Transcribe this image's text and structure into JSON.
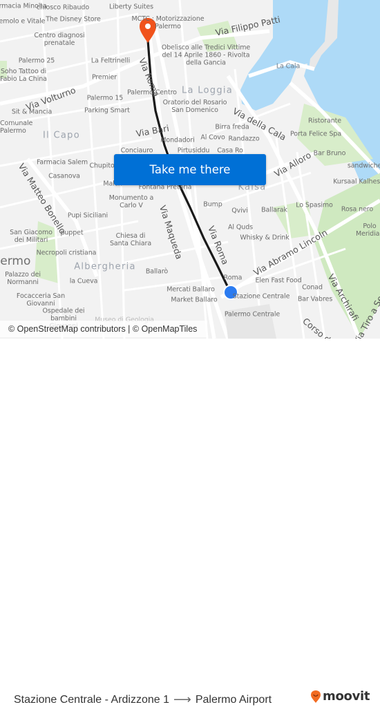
{
  "map": {
    "districts": [
      "La Loggia",
      "Il Capo",
      "Kalsa",
      "Albergheria"
    ],
    "city_label": "Palermo",
    "water_label": "La Cala",
    "streets": [
      "Via Filippo Patti",
      "Via Roma",
      "Via Volturno",
      "Via della Cala",
      "Via Bari",
      "Via Alloro",
      "Via Matteo Bonello",
      "Via Maqueda",
      "Via Roma",
      "Via Abramo Lincoln",
      "Via Archirafi",
      "Corso dei Mille",
      "Via Tiro a Segno"
    ],
    "pois": [
      "Farmacia Minolta",
      "chiosco Ribaudo",
      "Liberty Suites",
      "Tremolo e Vitale",
      "The Disney Store",
      "MCTC : Motorizzazione Palermo",
      "Centro diagnosi prenatale",
      "Palermo 25",
      "La Feltrinelli",
      "Obelisco alle Tredici Vittime del 14 Aprile 1860 - Rivolta della Gancia",
      "Soho Tattoo di Fabio La China",
      "Premier",
      "Palermo Centro",
      "Palermo 15",
      "Oratorio del Rosario San Domenico",
      "Sit & Mancia",
      "Parking Smart",
      "Comunale Palermo",
      "Birra freda",
      "Mondadori",
      "Al Covo",
      "Randazzo",
      "Ristorante",
      "Porta Felice Spa",
      "Conciauro",
      "Pirtusiddu",
      "Casa Ro",
      "Bar Bruno",
      "Farmacia Salem",
      "Chupitos",
      "sandwiches",
      "Casanova",
      "Malox",
      "Fontana Pretoria",
      "Kursaal Kalhesa",
      "Monumento a Carlo V",
      "Bump",
      "Qvivi",
      "Ballarak",
      "Lo Spasimo",
      "Rosa nero",
      "Pupi Siciliani",
      "Al Quds",
      "Polo Meridiana",
      "San Giacomo dei Militari",
      "puppet",
      "Whisky & Drink",
      "Chiesa di Santa Chiara",
      "Necropoli cristiana",
      "Palazzo dei Normanni",
      "la Cueva",
      "Ballarò",
      "Roma",
      "Elen Fast Food",
      "Conad",
      "Mercati Ballaro",
      "Stazione Centrale",
      "Bar Vabres",
      "Focacceria San Giovanni",
      "Market Ballaro",
      "Ospedale dei bambini Giovanni",
      "Palermo Centrale",
      "Museo di Geologia"
    ],
    "origin_marker": "current-location-dot",
    "destination_marker": "destination-pin",
    "colors": {
      "route": "#1a1a1a",
      "destination_pin": "#f0531c",
      "origin_dot": "#2b7bf0",
      "water": "#aedaf7",
      "park": "#cfe9c0",
      "land": "#f2f2f2",
      "road": "#ffffff"
    }
  },
  "cta": {
    "label": "Take me there",
    "color": "#0070d6"
  },
  "attribution": "© OpenStreetMap contributors | © OpenMapTiles",
  "footer": {
    "origin": "Stazione Centrale - Ardizzone 1",
    "arrow": "⟶",
    "destination": "Palermo Airport",
    "brand": "moovit",
    "brand_color": "#f26b21"
  }
}
